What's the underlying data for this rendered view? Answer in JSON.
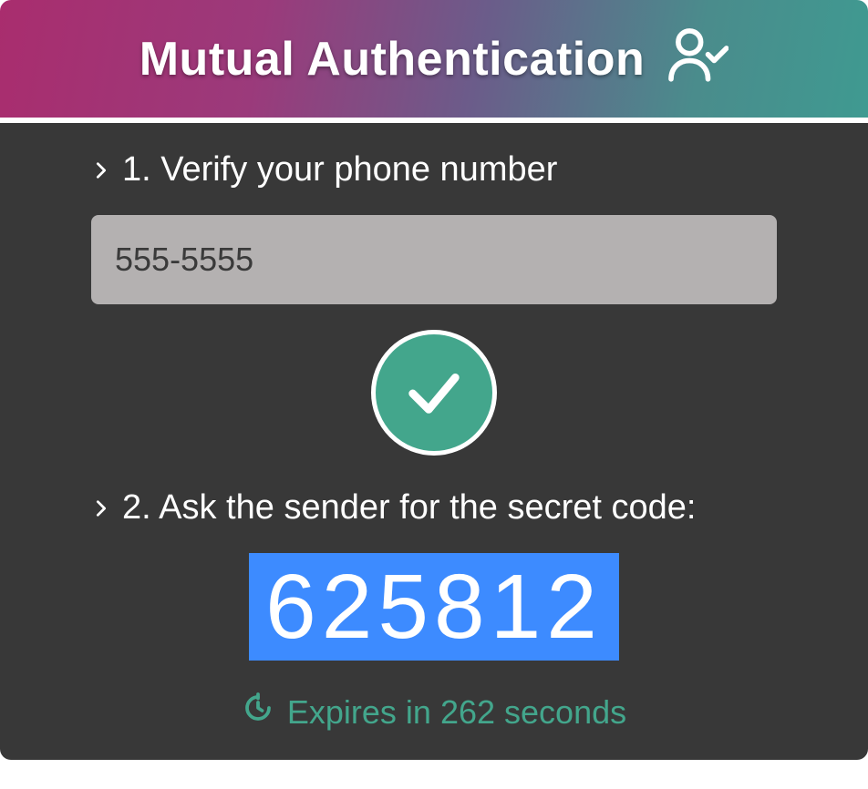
{
  "header": {
    "title": "Mutual Authentication"
  },
  "colors": {
    "accent": "#43a68c",
    "code_bg": "#3d8bff",
    "body_bg": "#383838"
  },
  "steps": {
    "verify": {
      "label": "1. Verify your phone number",
      "phone_value": "555-5555"
    },
    "ask": {
      "label": "2. Ask the sender for the secret code:",
      "code": "625812"
    }
  },
  "expiry": {
    "prefix": "Expires in ",
    "seconds": "262",
    "suffix": " seconds"
  }
}
